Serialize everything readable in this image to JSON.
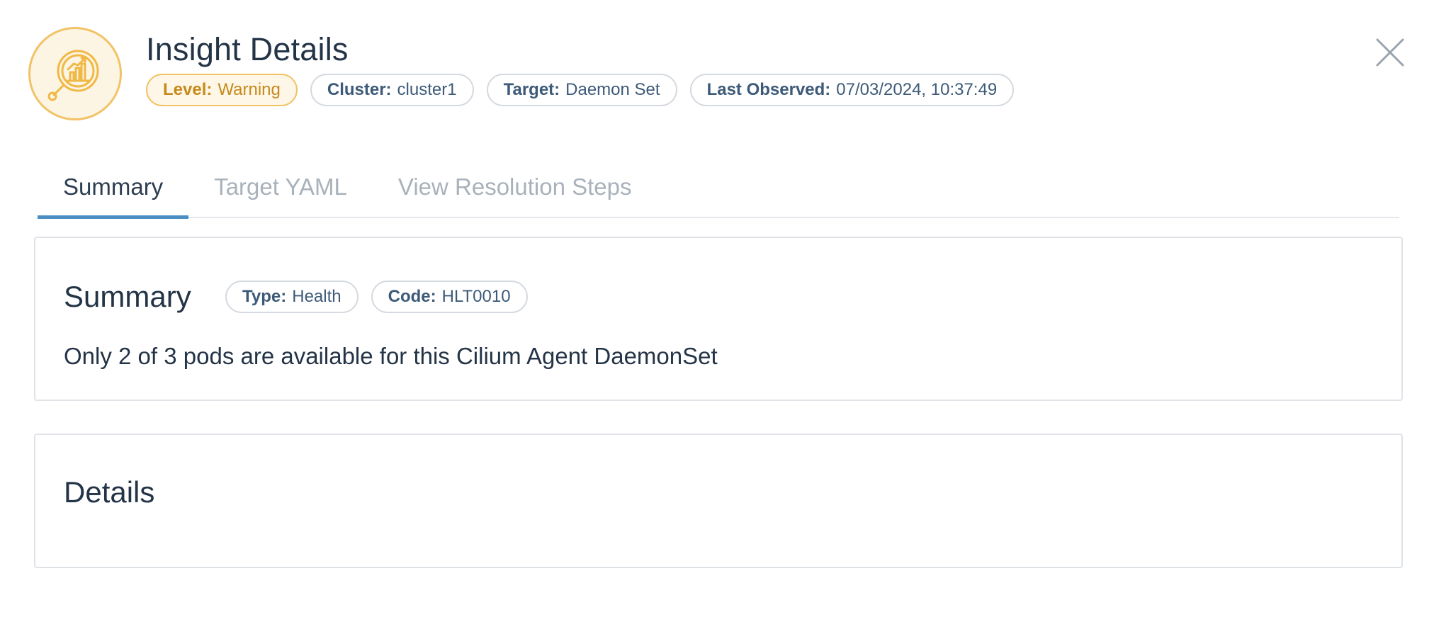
{
  "header": {
    "icon": "insights-magnifier-chart-icon",
    "title": "Insight Details",
    "close_icon": "close-icon",
    "badges": {
      "level": {
        "key": "Level:",
        "value": "Warning",
        "color": "#c58a1a"
      },
      "cluster": {
        "key": "Cluster:",
        "value": "cluster1"
      },
      "target": {
        "key": "Target:",
        "value": "Daemon Set"
      },
      "last_observed": {
        "key": "Last Observed:",
        "value": "07/03/2024, 10:37:49"
      }
    }
  },
  "tabs": [
    {
      "label": "Summary",
      "active": true
    },
    {
      "label": "Target YAML",
      "active": false
    },
    {
      "label": "View Resolution Steps",
      "active": false
    }
  ],
  "summary": {
    "title": "Summary",
    "type": {
      "key": "Type:",
      "value": "Health"
    },
    "code": {
      "key": "Code:",
      "value": "HLT0010"
    },
    "text": "Only 2 of 3 pods are available for this Cilium Agent DaemonSet"
  },
  "details": {
    "title": "Details"
  },
  "colors": {
    "accent_tab": "#4a8ec4",
    "warning_border": "#f2c266",
    "warning_bg": "#fef6e6",
    "badge_text": "#3d5a78"
  }
}
